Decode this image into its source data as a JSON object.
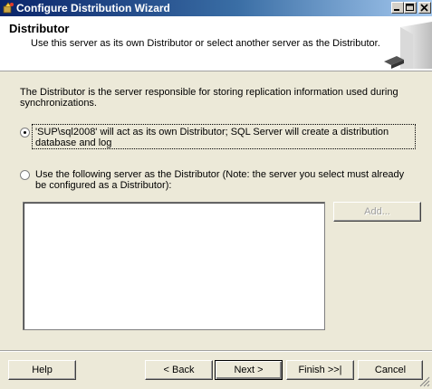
{
  "window": {
    "title": "Configure Distribution Wizard"
  },
  "header": {
    "title": "Distributor",
    "subtitle": "Use this server as its own Distributor or select another server as the Distributor."
  },
  "description": "The Distributor is the server responsible for storing replication information used during synchronizations.",
  "options": [
    {
      "label": "'SUP\\sql2008' will act as its own Distributor; SQL Server will create a distribution database and log",
      "selected": true
    },
    {
      "label": "Use the following server as the Distributor (Note: the server you select must already be configured as a Distributor):",
      "selected": false
    }
  ],
  "server_list": {
    "items": []
  },
  "buttons": {
    "add": "Add...",
    "help": "Help",
    "back": "< Back",
    "next": "Next >",
    "finish": "Finish >>|",
    "cancel": "Cancel"
  }
}
